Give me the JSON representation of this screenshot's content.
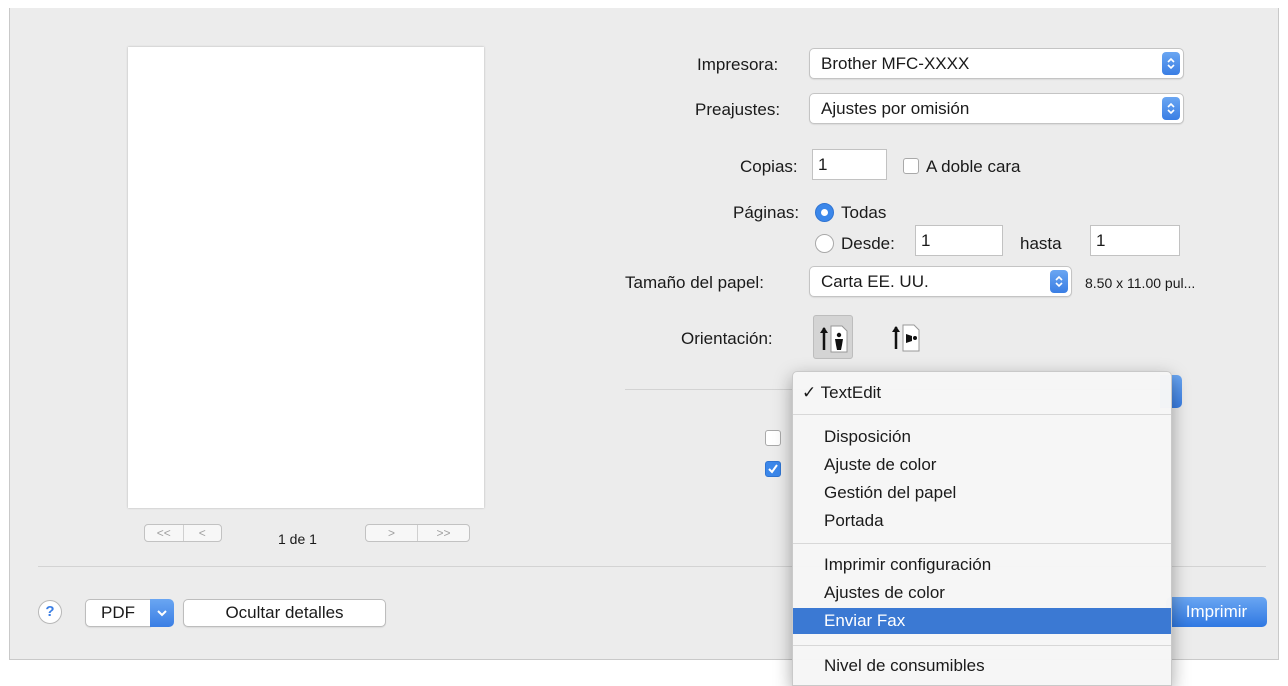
{
  "preview": {
    "page_indicator": "1 de 1",
    "first_label": "<<",
    "prev_label": "<",
    "next_label": ">",
    "last_label": ">>"
  },
  "printer": {
    "label": "Impresora:",
    "value": "Brother MFC-XXXX"
  },
  "presets": {
    "label": "Preajustes:",
    "value": "Ajustes por omisión"
  },
  "copies": {
    "label": "Copias:",
    "value": "1",
    "duplex_label": "A doble cara",
    "duplex_checked": false
  },
  "pages": {
    "label": "Páginas:",
    "all_label": "Todas",
    "from_label": "Desde:",
    "from_value": "1",
    "to_label": "hasta",
    "to_value": "1",
    "selected": "all"
  },
  "paper_size": {
    "label": "Tamaño del papel:",
    "value": "Carta EE. UU.",
    "dimensions": "8.50 x 11.00 pul..."
  },
  "orientation": {
    "label": "Orientación:",
    "selected": "portrait"
  },
  "hidden_checkboxes": [
    {
      "checked": false
    },
    {
      "checked": true
    }
  ],
  "footer": {
    "help_label": "?",
    "pdf_label": "PDF",
    "hide_details_label": "Ocultar detalles",
    "print_label": "Imprimir"
  },
  "menu": {
    "checked_item": "TextEdit",
    "group1": [
      "Disposición",
      "Ajuste de color",
      "Gestión del papel",
      "Portada"
    ],
    "group2": [
      "Imprimir configuración",
      "Ajustes de color",
      "Enviar Fax"
    ],
    "group3": [
      "Nivel de consumibles"
    ],
    "highlighted": "Enviar Fax"
  },
  "colors": {
    "accent": "#3b79d3",
    "dialog_bg": "#ececec"
  }
}
